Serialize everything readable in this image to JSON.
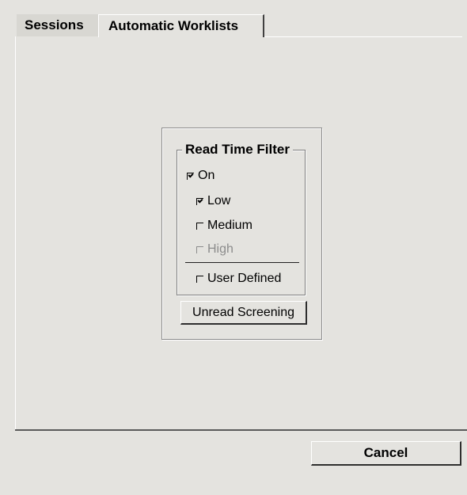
{
  "tabs": [
    {
      "label": "Sessions",
      "active": false
    },
    {
      "label": "Automatic Worklists",
      "active": true
    }
  ],
  "read_time_filter": {
    "title": "Read Time Filter",
    "on": {
      "label": "On",
      "checked": true
    },
    "options": [
      {
        "label": "Low",
        "checked": true,
        "enabled": true
      },
      {
        "label": "Medium",
        "checked": false,
        "enabled": true
      },
      {
        "label": "High",
        "checked": false,
        "enabled": false
      }
    ],
    "user_defined": {
      "label": "User Defined",
      "checked": false
    }
  },
  "buttons": {
    "unread_screening": "Unread Screening",
    "cancel": "Cancel"
  },
  "colors": {
    "background": "#e4e3df",
    "disabled_text": "#8c8c8c"
  }
}
